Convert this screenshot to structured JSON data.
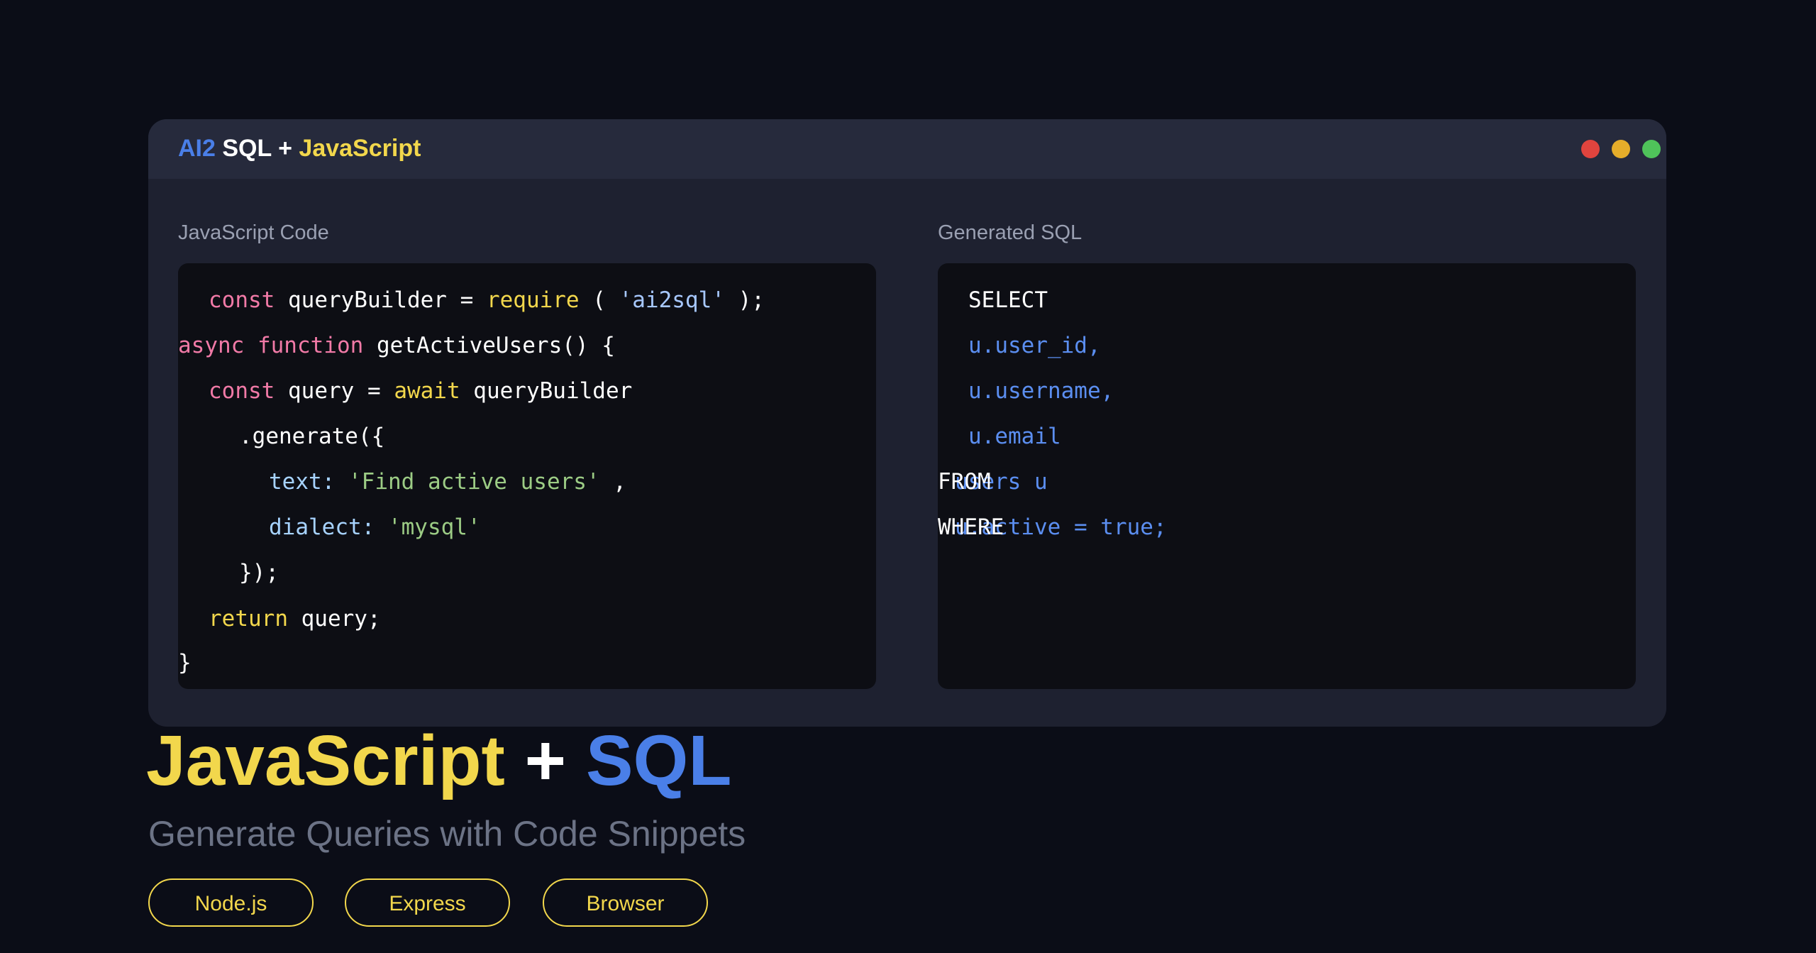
{
  "window": {
    "title_ai2": "AI2",
    "title_sql": "SQL +",
    "title_js": "JavaScript",
    "controls": [
      "close",
      "minimize",
      "maximize"
    ],
    "control_colors": {
      "close": "#e0443e",
      "minimize": "#e5ad2a",
      "maximize": "#4fc35a"
    }
  },
  "js_panel": {
    "label": "JavaScript Code",
    "lines": {
      "l1": {
        "kw": "const",
        "name": " queryBuilder = ",
        "fn": "require",
        "open": " ( ",
        "str": "'ai2sql'",
        "close": " );"
      },
      "l2": {
        "kw": "async function",
        "rest": " getActiveUsers() {"
      },
      "l3": {
        "kw": "const",
        "name": " query = ",
        "await": "await",
        "rest": " queryBuilder"
      },
      "l4": {
        "text": ".generate({"
      },
      "l5": {
        "key": "text:",
        "str": " 'Find active users'",
        "rest": " ,"
      },
      "l6": {
        "key": "dialect:",
        "str": " 'mysql'"
      },
      "l7": {
        "text": "});"
      },
      "l8": {
        "kw": "return",
        "rest": " query;"
      },
      "l9": {
        "text": "}"
      }
    }
  },
  "sql_panel": {
    "label": "Generated SQL",
    "lines": {
      "select": "SELECT",
      "col1": "u.user_id,",
      "col2": "u.username,",
      "col3": "u.email",
      "from_kw": "FROM",
      "from_tbl": "users u",
      "where_kw": "WHERE",
      "where_cond": "u.active = true;"
    }
  },
  "hero": {
    "js": "JavaScript",
    "plus": "+",
    "sql": "SQL",
    "subtitle": "Generate Queries with Code Snippets"
  },
  "tags": [
    "Node.js",
    "Express",
    "Browser"
  ],
  "colors": {
    "background": "#0b0d17",
    "accent_yellow": "#f2d74c",
    "accent_blue": "#4a7fe8"
  }
}
